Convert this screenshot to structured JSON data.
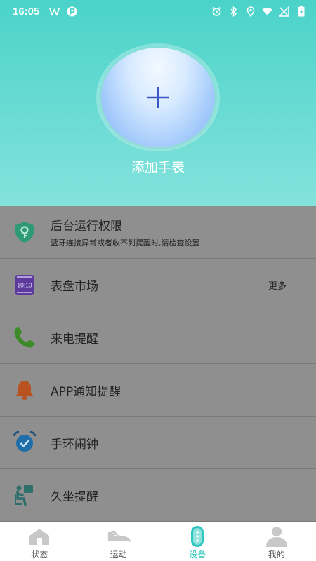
{
  "status_bar": {
    "time": "16:05",
    "icons": [
      "w-app-icon",
      "p-app-icon",
      "alarm-icon",
      "bluetooth-icon",
      "location-icon",
      "wifi-icon",
      "no-signal-icon",
      "battery-icon"
    ]
  },
  "header": {
    "add_label": "添加手表",
    "gradient_top": "#4ad3c9",
    "gradient_bottom": "#84e2dc"
  },
  "list": {
    "items": [
      {
        "icon": "shield-key-icon",
        "title": "后台运行权限",
        "subtitle": "蓝牙连接异常或者收不到提醒时,请检查设置"
      },
      {
        "icon": "watch-face-icon",
        "title": "表盘市场",
        "more": "更多",
        "face_time": "10:10"
      },
      {
        "icon": "phone-icon",
        "title": "来电提醒"
      },
      {
        "icon": "bell-icon",
        "title": "APP通知提醒"
      },
      {
        "icon": "alarm-clock-icon",
        "title": "手环闹钟"
      },
      {
        "icon": "sedentary-icon",
        "title": "久坐提醒"
      }
    ]
  },
  "nav": {
    "tabs": [
      {
        "label": "状态",
        "icon": "home-icon",
        "active": false
      },
      {
        "label": "运动",
        "icon": "shoe-icon",
        "active": false
      },
      {
        "label": "设备",
        "icon": "band-icon",
        "active": true
      },
      {
        "label": "我的",
        "icon": "profile-icon",
        "active": false
      }
    ],
    "active_color": "#2ec6bd"
  }
}
